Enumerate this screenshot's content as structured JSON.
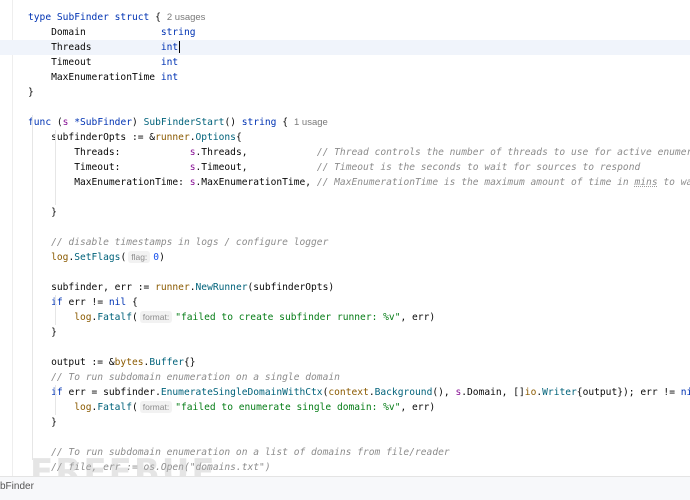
{
  "editor": {
    "caret_line": 3,
    "lines": [
      [
        {
          "t": "type ",
          "c": "kw"
        },
        {
          "t": "SubFinder ",
          "c": "type"
        },
        {
          "t": "struct ",
          "c": "kw"
        },
        {
          "t": "{"
        },
        {
          "u": "2 usages"
        }
      ],
      [
        {
          "t": "    Domain             "
        },
        {
          "t": "string",
          "c": "type"
        }
      ],
      [
        {
          "t": "    Threads            "
        },
        {
          "t": "int",
          "c": "type"
        },
        {
          "caret": true
        }
      ],
      [
        {
          "t": "    Timeout            "
        },
        {
          "t": "int",
          "c": "type"
        }
      ],
      [
        {
          "t": "    MaxEnumerationTime "
        },
        {
          "t": "int",
          "c": "type"
        }
      ],
      [
        {
          "t": "}"
        }
      ],
      [],
      [
        {
          "t": "func ",
          "c": "kw"
        },
        {
          "t": "("
        },
        {
          "t": "s ",
          "c": "recv"
        },
        {
          "t": "*SubFinder",
          "c": "type"
        },
        {
          "t": ") "
        },
        {
          "t": "SubFinderStart",
          "c": "fn"
        },
        {
          "t": "() "
        },
        {
          "t": "string",
          "c": "type"
        },
        {
          "t": " {"
        },
        {
          "u": "1 usage"
        }
      ],
      [
        {
          "t": "    subfinderOpts := &"
        },
        {
          "t": "runner",
          "c": "pkg"
        },
        {
          "t": "."
        },
        {
          "t": "Options",
          "c": "fn"
        },
        {
          "t": "{"
        }
      ],
      [
        {
          "t": "        Threads:            "
        },
        {
          "t": "s",
          "c": "recv"
        },
        {
          "t": ".Threads,            "
        },
        {
          "t": "// Thread controls the number of threads to use for active enumerations",
          "c": "cmt"
        }
      ],
      [
        {
          "t": "        Timeout:            "
        },
        {
          "t": "s",
          "c": "recv"
        },
        {
          "t": ".Timeout,            "
        },
        {
          "t": "// Timeout is the seconds to wait for sources to respond",
          "c": "cmt"
        }
      ],
      [
        {
          "t": "        MaxEnumerationTime: "
        },
        {
          "t": "s",
          "c": "recv"
        },
        {
          "t": ".MaxEnumerationTime, "
        },
        {
          "t": "// MaxEnumerationTime is the maximum amount of time in ",
          "c": "cmt"
        },
        {
          "t": "mins",
          "c": "cmt sq"
        },
        {
          "t": " to wait for e",
          "c": "cmt"
        }
      ],
      [],
      [
        {
          "t": "    }"
        }
      ],
      [],
      [
        {
          "t": "    // disable timestamps in logs / configure logger",
          "c": "cmt"
        }
      ],
      [
        {
          "t": "    "
        },
        {
          "t": "log",
          "c": "pkg"
        },
        {
          "t": "."
        },
        {
          "t": "SetFlags",
          "c": "fn"
        },
        {
          "t": "("
        },
        {
          "h": "flag:"
        },
        {
          "t": "0",
          "c": "num"
        },
        {
          "t": ")"
        }
      ],
      [],
      [
        {
          "t": "    subfinder, err := "
        },
        {
          "t": "runner",
          "c": "pkg"
        },
        {
          "t": "."
        },
        {
          "t": "NewRunner",
          "c": "fn"
        },
        {
          "t": "(subfinderOpts)"
        }
      ],
      [
        {
          "t": "    "
        },
        {
          "t": "if ",
          "c": "kw"
        },
        {
          "t": "err != "
        },
        {
          "t": "nil",
          "c": "kw"
        },
        {
          "t": " {"
        }
      ],
      [
        {
          "t": "        "
        },
        {
          "t": "log",
          "c": "pkg"
        },
        {
          "t": "."
        },
        {
          "t": "Fatalf",
          "c": "fn"
        },
        {
          "t": "("
        },
        {
          "h": "format:"
        },
        {
          "t": "\"failed to create subfinder runner: %v\"",
          "c": "str"
        },
        {
          "t": ", err)"
        }
      ],
      [
        {
          "t": "    }"
        }
      ],
      [],
      [
        {
          "t": "    output := &"
        },
        {
          "t": "bytes",
          "c": "pkg"
        },
        {
          "t": "."
        },
        {
          "t": "Buffer",
          "c": "fn"
        },
        {
          "t": "{}"
        }
      ],
      [
        {
          "t": "    // To run subdomain enumeration on a single domain",
          "c": "cmt"
        }
      ],
      [
        {
          "t": "    "
        },
        {
          "t": "if ",
          "c": "kw"
        },
        {
          "t": "err = subfinder."
        },
        {
          "t": "EnumerateSingleDomainWithCtx",
          "c": "fn"
        },
        {
          "t": "("
        },
        {
          "t": "context",
          "c": "pkg"
        },
        {
          "t": "."
        },
        {
          "t": "Background",
          "c": "fn"
        },
        {
          "t": "(), "
        },
        {
          "t": "s",
          "c": "recv"
        },
        {
          "t": ".Domain, []"
        },
        {
          "t": "io",
          "c": "pkg"
        },
        {
          "t": "."
        },
        {
          "t": "Writer",
          "c": "fn"
        },
        {
          "t": "{output}); err != "
        },
        {
          "t": "nil",
          "c": "kw"
        },
        {
          "t": " {"
        }
      ],
      [
        {
          "t": "        "
        },
        {
          "t": "log",
          "c": "pkg"
        },
        {
          "t": "."
        },
        {
          "t": "Fatalf",
          "c": "fn"
        },
        {
          "t": "("
        },
        {
          "h": "format:"
        },
        {
          "t": "\"failed to enumerate single domain: %v\"",
          "c": "str"
        },
        {
          "t": ", err)"
        }
      ],
      [
        {
          "t": "    }"
        }
      ],
      [],
      [
        {
          "t": "    // To run subdomain enumeration on a list of domains from file/reader",
          "c": "cmt"
        }
      ],
      [
        {
          "t": "    // file, err := os.Open(\"domains.txt\")",
          "c": "cmt"
        }
      ]
    ]
  },
  "statusbar": {
    "label": "bFinder"
  },
  "watermark": "FREEBUF"
}
